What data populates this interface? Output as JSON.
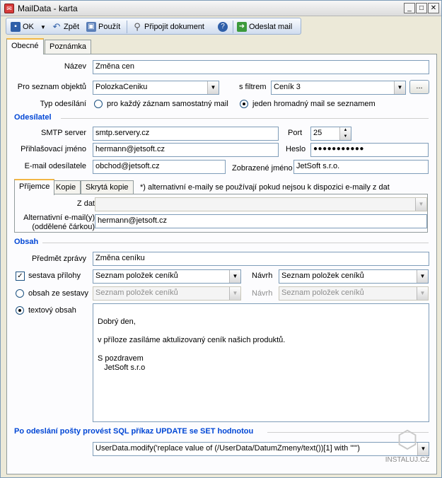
{
  "window": {
    "title": "MailData - karta"
  },
  "toolbar": {
    "ok": "OK",
    "back": "Zpět",
    "apply": "Použít",
    "attach": "Připojit dokument",
    "send": "Odeslat mail"
  },
  "tabs": [
    "Obecné",
    "Poznámka"
  ],
  "general": {
    "name_label": "Název",
    "name_value": "Změna cen",
    "list_label": "Pro seznam objektů",
    "list_value": "PolozkaCeniku",
    "filter_label": "s filtrem",
    "filter_value": "Ceník 3",
    "filter_more": "...",
    "send_type_label": "Typ odesílání",
    "send_type_opt1": "pro každý záznam samostatný mail",
    "send_type_opt2": "jeden hromadný mail se seznamem",
    "send_type_selected": 2
  },
  "sender": {
    "title": "Odesílatel",
    "smtp_label": "SMTP server",
    "smtp_value": "smtp.servery.cz",
    "port_label": "Port",
    "port_value": "25",
    "login_label": "Přihlašovací jméno",
    "login_value": "hermann@jetsoft.cz",
    "password_label": "Heslo",
    "password_value": "●●●●●●●●●●●",
    "email_label": "E-mail odesílatele",
    "email_value": "obchod@jetsoft.cz",
    "display_label": "Zobrazené jméno",
    "display_value": "JetSoft s.r.o."
  },
  "recipients": {
    "tabs": [
      "Příjemce",
      "Kopie",
      "Skrytá kopie"
    ],
    "note": "*) alternativní e-maily se používají pokud nejsou k dispozici e-maily z dat",
    "from_data_label": "Z dat",
    "from_data_value": "",
    "alt_label_1": "Alternativní e-mail(y)",
    "alt_label_2": "(oddělené čárkou)",
    "alt_value": "hermann@jetsoft.cz"
  },
  "content": {
    "title": "Obsah",
    "subject_label": "Předmět zprávy",
    "subject_value": "Změna ceníku",
    "attach_label": "sestava přílohy",
    "attach_checked": true,
    "attach_value": "Seznam položek ceníků",
    "design_label": "Návrh",
    "design_value": "Seznam položek ceníků",
    "report_label": "obsah ze sestavy",
    "report_value": "Seznam položek ceníků",
    "report_design_value": "Seznam položek ceníků",
    "text_label": "textový obsah",
    "body_lines": [
      "",
      "Dobrý den,",
      "",
      "v příloze zasíláme aktulizovaný ceník našich produktů.",
      "",
      "S pozdravem",
      "   JetSoft s.r.o"
    ]
  },
  "sql": {
    "title": "Po odeslání pošty provést SQL příkaz UPDATE se SET hodnotou",
    "value": "UserData.modify('replace value of (/UserData/DatumZmeny/text())[1] with \"\"')"
  },
  "watermark": {
    "text": "INSTALUJ.CZ"
  }
}
